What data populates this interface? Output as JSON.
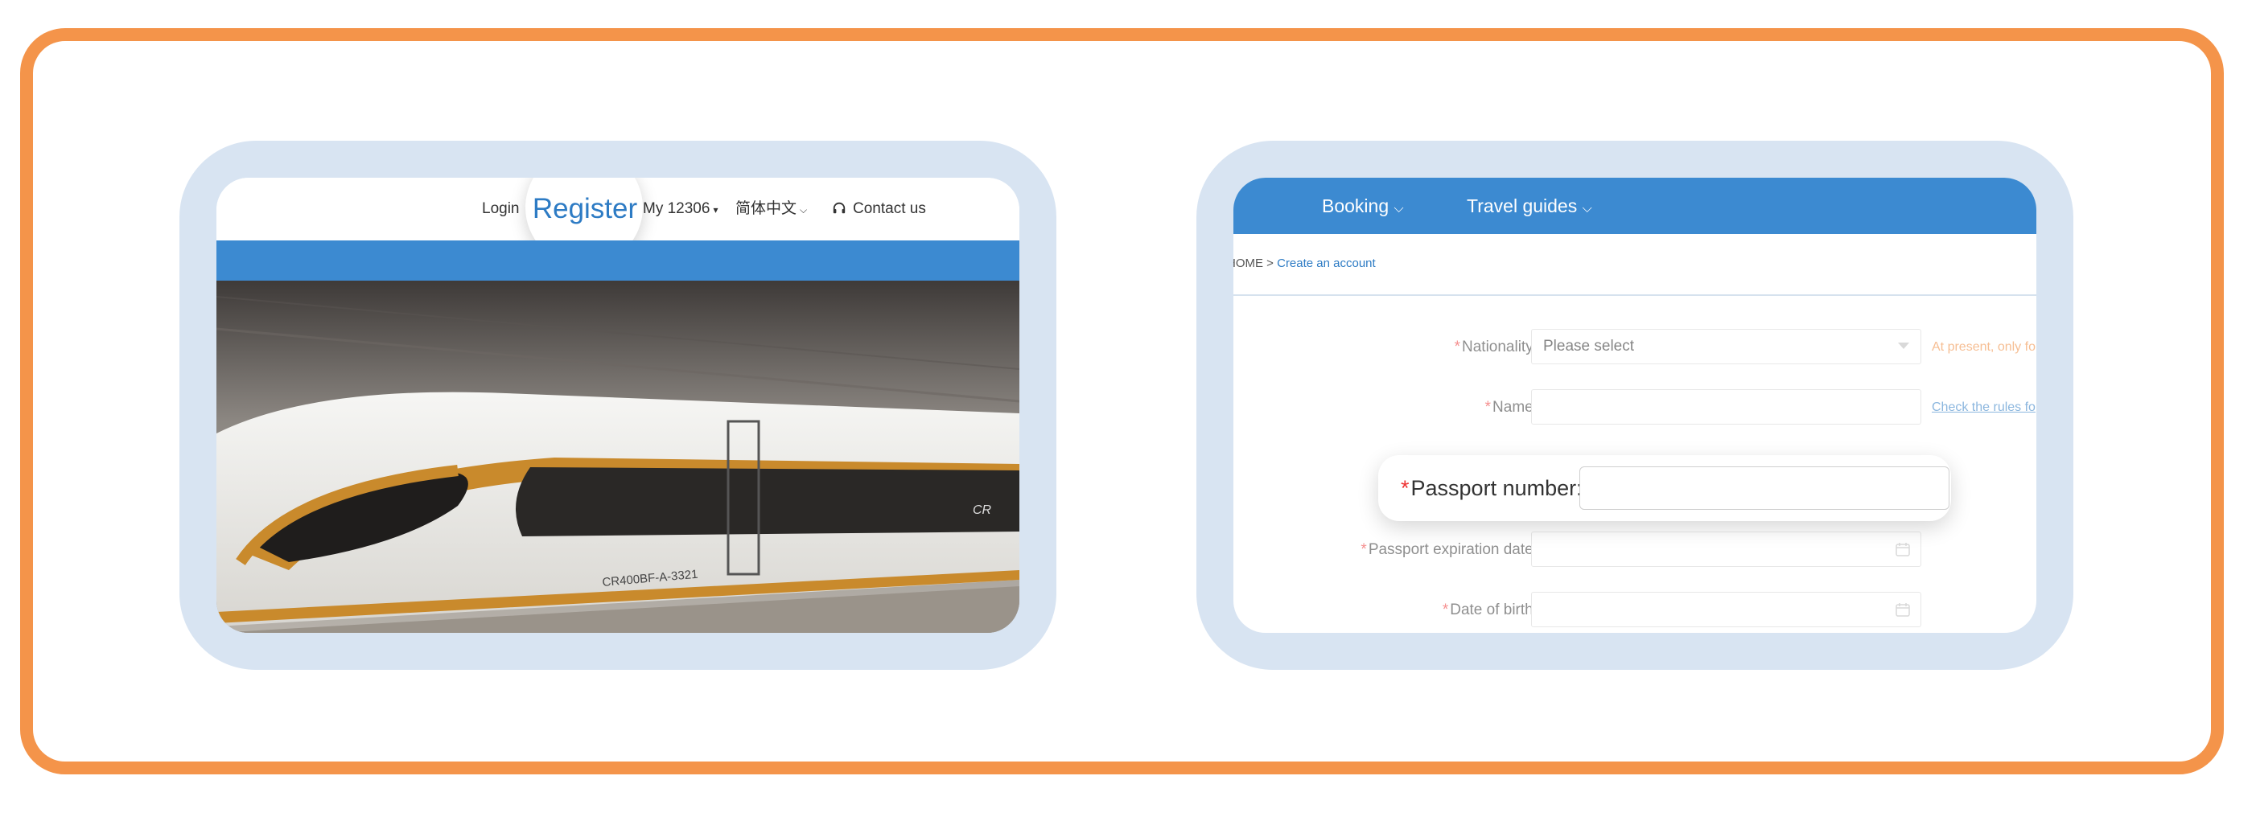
{
  "left_panel": {
    "nav": {
      "login": "Login",
      "register": "Register",
      "my_account": "My 12306",
      "language": "简体中文",
      "contact": "Contact us"
    },
    "hero": {
      "train_code": "CR400BF-A-3321",
      "logo_text": "CR"
    }
  },
  "right_panel": {
    "menu": {
      "booking": "Booking",
      "travel_guides": "Travel guides"
    },
    "breadcrumb": {
      "home": "HOME >",
      "current": "Create an account"
    },
    "form": {
      "nationality": {
        "label": "Nationality",
        "value": "Please select",
        "hint": "At present, only fo"
      },
      "name": {
        "label": "Name",
        "value": "",
        "hint": "Check the rules fo"
      },
      "passport_number": {
        "label": "Passport number",
        "value": ""
      },
      "passport_expiration": {
        "label": "Passport expiration date",
        "value": ""
      },
      "date_of_birth": {
        "label": "Date of birth",
        "value": ""
      },
      "required_mark": "*",
      "colon": ":"
    }
  },
  "colors": {
    "frame_orange": "#F4944A",
    "card_blue": "#D8E4F2",
    "nav_blue": "#3C8AD1",
    "link_blue": "#2D7BC4",
    "required_red": "#EE3333",
    "hint_orange": "#F08A3C"
  }
}
